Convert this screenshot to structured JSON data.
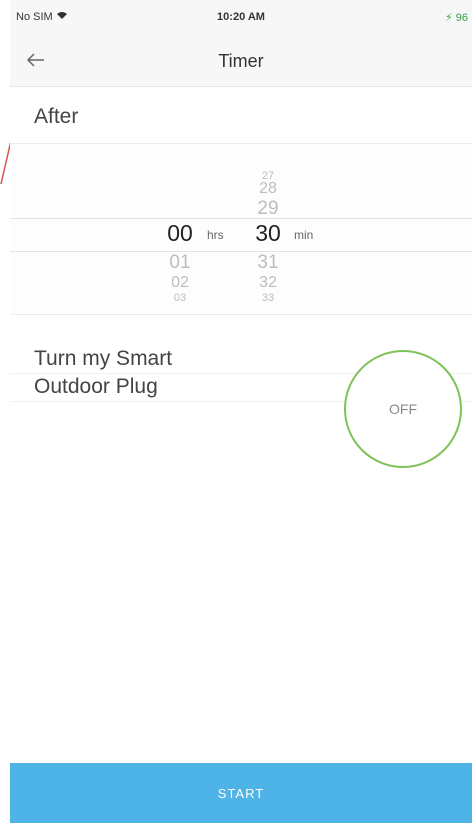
{
  "status_bar": {
    "carrier": "No SIM",
    "time": "10:20 AM",
    "battery": "96"
  },
  "nav": {
    "title": "Timer",
    "back_icon": "arrow-left-icon"
  },
  "after": {
    "label": "After"
  },
  "picker": {
    "hours": {
      "above": [
        "",
        ""
      ],
      "selected": "00",
      "below": [
        "01",
        "02",
        "03"
      ],
      "unit": "hrs"
    },
    "minutes": {
      "above": [
        "27",
        "28",
        "29"
      ],
      "selected": "30",
      "below": [
        "31",
        "32",
        "33"
      ],
      "unit": "min"
    }
  },
  "action": {
    "label_line1": "Turn my Smart",
    "label_line2": "Outdoor Plug",
    "toggle_value": "OFF",
    "toggle_color": "#7fc25a"
  },
  "footer": {
    "start_label": "START",
    "start_color": "#4eb3e6"
  },
  "colors": {
    "annotation": "#d9534f"
  }
}
